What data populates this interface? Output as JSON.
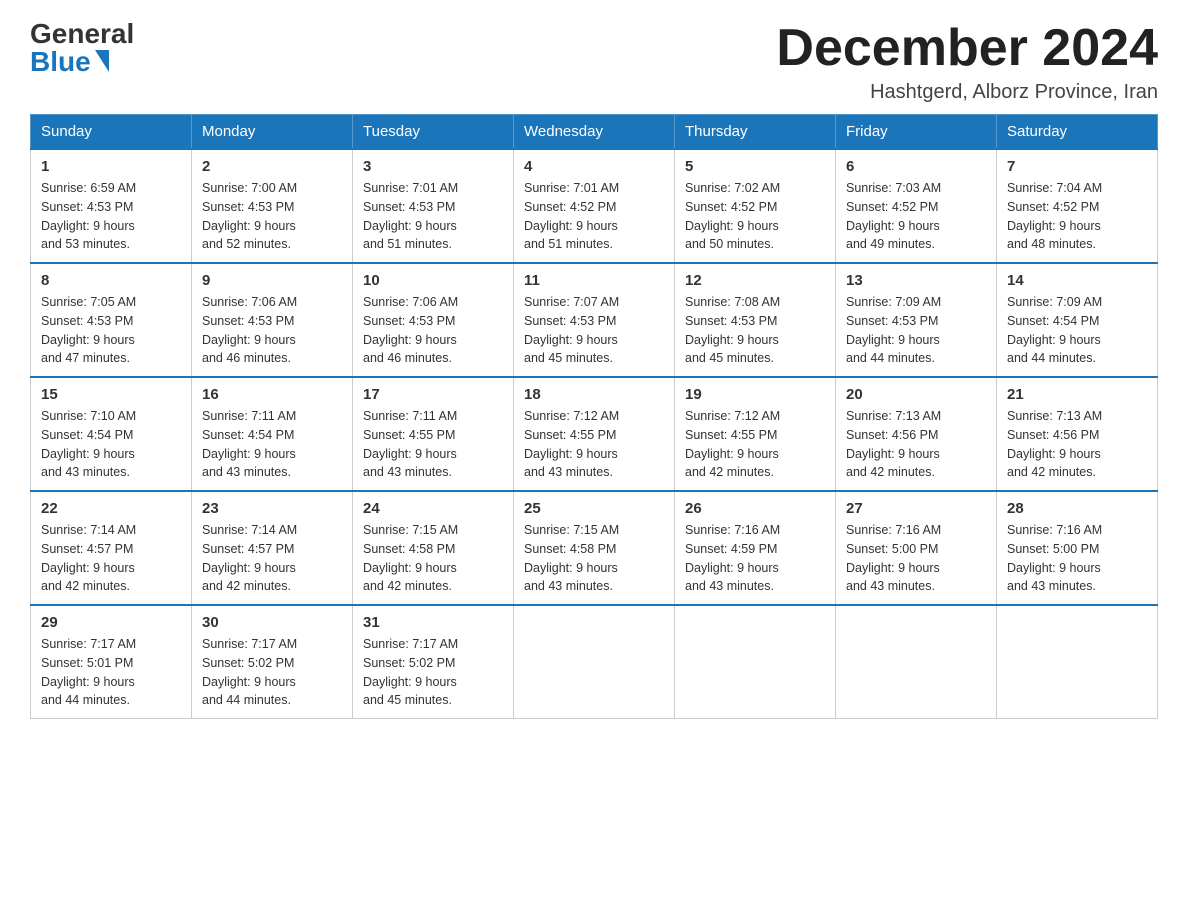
{
  "logo": {
    "general": "General",
    "blue": "Blue"
  },
  "header": {
    "title": "December 2024",
    "location": "Hashtgerd, Alborz Province, Iran"
  },
  "days_of_week": [
    "Sunday",
    "Monday",
    "Tuesday",
    "Wednesday",
    "Thursday",
    "Friday",
    "Saturday"
  ],
  "weeks": [
    [
      {
        "day": "1",
        "sunrise": "6:59 AM",
        "sunset": "4:53 PM",
        "daylight": "9 hours and 53 minutes."
      },
      {
        "day": "2",
        "sunrise": "7:00 AM",
        "sunset": "4:53 PM",
        "daylight": "9 hours and 52 minutes."
      },
      {
        "day": "3",
        "sunrise": "7:01 AM",
        "sunset": "4:53 PM",
        "daylight": "9 hours and 51 minutes."
      },
      {
        "day": "4",
        "sunrise": "7:01 AM",
        "sunset": "4:52 PM",
        "daylight": "9 hours and 51 minutes."
      },
      {
        "day": "5",
        "sunrise": "7:02 AM",
        "sunset": "4:52 PM",
        "daylight": "9 hours and 50 minutes."
      },
      {
        "day": "6",
        "sunrise": "7:03 AM",
        "sunset": "4:52 PM",
        "daylight": "9 hours and 49 minutes."
      },
      {
        "day": "7",
        "sunrise": "7:04 AM",
        "sunset": "4:52 PM",
        "daylight": "9 hours and 48 minutes."
      }
    ],
    [
      {
        "day": "8",
        "sunrise": "7:05 AM",
        "sunset": "4:53 PM",
        "daylight": "9 hours and 47 minutes."
      },
      {
        "day": "9",
        "sunrise": "7:06 AM",
        "sunset": "4:53 PM",
        "daylight": "9 hours and 46 minutes."
      },
      {
        "day": "10",
        "sunrise": "7:06 AM",
        "sunset": "4:53 PM",
        "daylight": "9 hours and 46 minutes."
      },
      {
        "day": "11",
        "sunrise": "7:07 AM",
        "sunset": "4:53 PM",
        "daylight": "9 hours and 45 minutes."
      },
      {
        "day": "12",
        "sunrise": "7:08 AM",
        "sunset": "4:53 PM",
        "daylight": "9 hours and 45 minutes."
      },
      {
        "day": "13",
        "sunrise": "7:09 AM",
        "sunset": "4:53 PM",
        "daylight": "9 hours and 44 minutes."
      },
      {
        "day": "14",
        "sunrise": "7:09 AM",
        "sunset": "4:54 PM",
        "daylight": "9 hours and 44 minutes."
      }
    ],
    [
      {
        "day": "15",
        "sunrise": "7:10 AM",
        "sunset": "4:54 PM",
        "daylight": "9 hours and 43 minutes."
      },
      {
        "day": "16",
        "sunrise": "7:11 AM",
        "sunset": "4:54 PM",
        "daylight": "9 hours and 43 minutes."
      },
      {
        "day": "17",
        "sunrise": "7:11 AM",
        "sunset": "4:55 PM",
        "daylight": "9 hours and 43 minutes."
      },
      {
        "day": "18",
        "sunrise": "7:12 AM",
        "sunset": "4:55 PM",
        "daylight": "9 hours and 43 minutes."
      },
      {
        "day": "19",
        "sunrise": "7:12 AM",
        "sunset": "4:55 PM",
        "daylight": "9 hours and 42 minutes."
      },
      {
        "day": "20",
        "sunrise": "7:13 AM",
        "sunset": "4:56 PM",
        "daylight": "9 hours and 42 minutes."
      },
      {
        "day": "21",
        "sunrise": "7:13 AM",
        "sunset": "4:56 PM",
        "daylight": "9 hours and 42 minutes."
      }
    ],
    [
      {
        "day": "22",
        "sunrise": "7:14 AM",
        "sunset": "4:57 PM",
        "daylight": "9 hours and 42 minutes."
      },
      {
        "day": "23",
        "sunrise": "7:14 AM",
        "sunset": "4:57 PM",
        "daylight": "9 hours and 42 minutes."
      },
      {
        "day": "24",
        "sunrise": "7:15 AM",
        "sunset": "4:58 PM",
        "daylight": "9 hours and 42 minutes."
      },
      {
        "day": "25",
        "sunrise": "7:15 AM",
        "sunset": "4:58 PM",
        "daylight": "9 hours and 43 minutes."
      },
      {
        "day": "26",
        "sunrise": "7:16 AM",
        "sunset": "4:59 PM",
        "daylight": "9 hours and 43 minutes."
      },
      {
        "day": "27",
        "sunrise": "7:16 AM",
        "sunset": "5:00 PM",
        "daylight": "9 hours and 43 minutes."
      },
      {
        "day": "28",
        "sunrise": "7:16 AM",
        "sunset": "5:00 PM",
        "daylight": "9 hours and 43 minutes."
      }
    ],
    [
      {
        "day": "29",
        "sunrise": "7:17 AM",
        "sunset": "5:01 PM",
        "daylight": "9 hours and 44 minutes."
      },
      {
        "day": "30",
        "sunrise": "7:17 AM",
        "sunset": "5:02 PM",
        "daylight": "9 hours and 44 minutes."
      },
      {
        "day": "31",
        "sunrise": "7:17 AM",
        "sunset": "5:02 PM",
        "daylight": "9 hours and 45 minutes."
      },
      null,
      null,
      null,
      null
    ]
  ],
  "labels": {
    "sunrise": "Sunrise:",
    "sunset": "Sunset:",
    "daylight": "Daylight:"
  }
}
